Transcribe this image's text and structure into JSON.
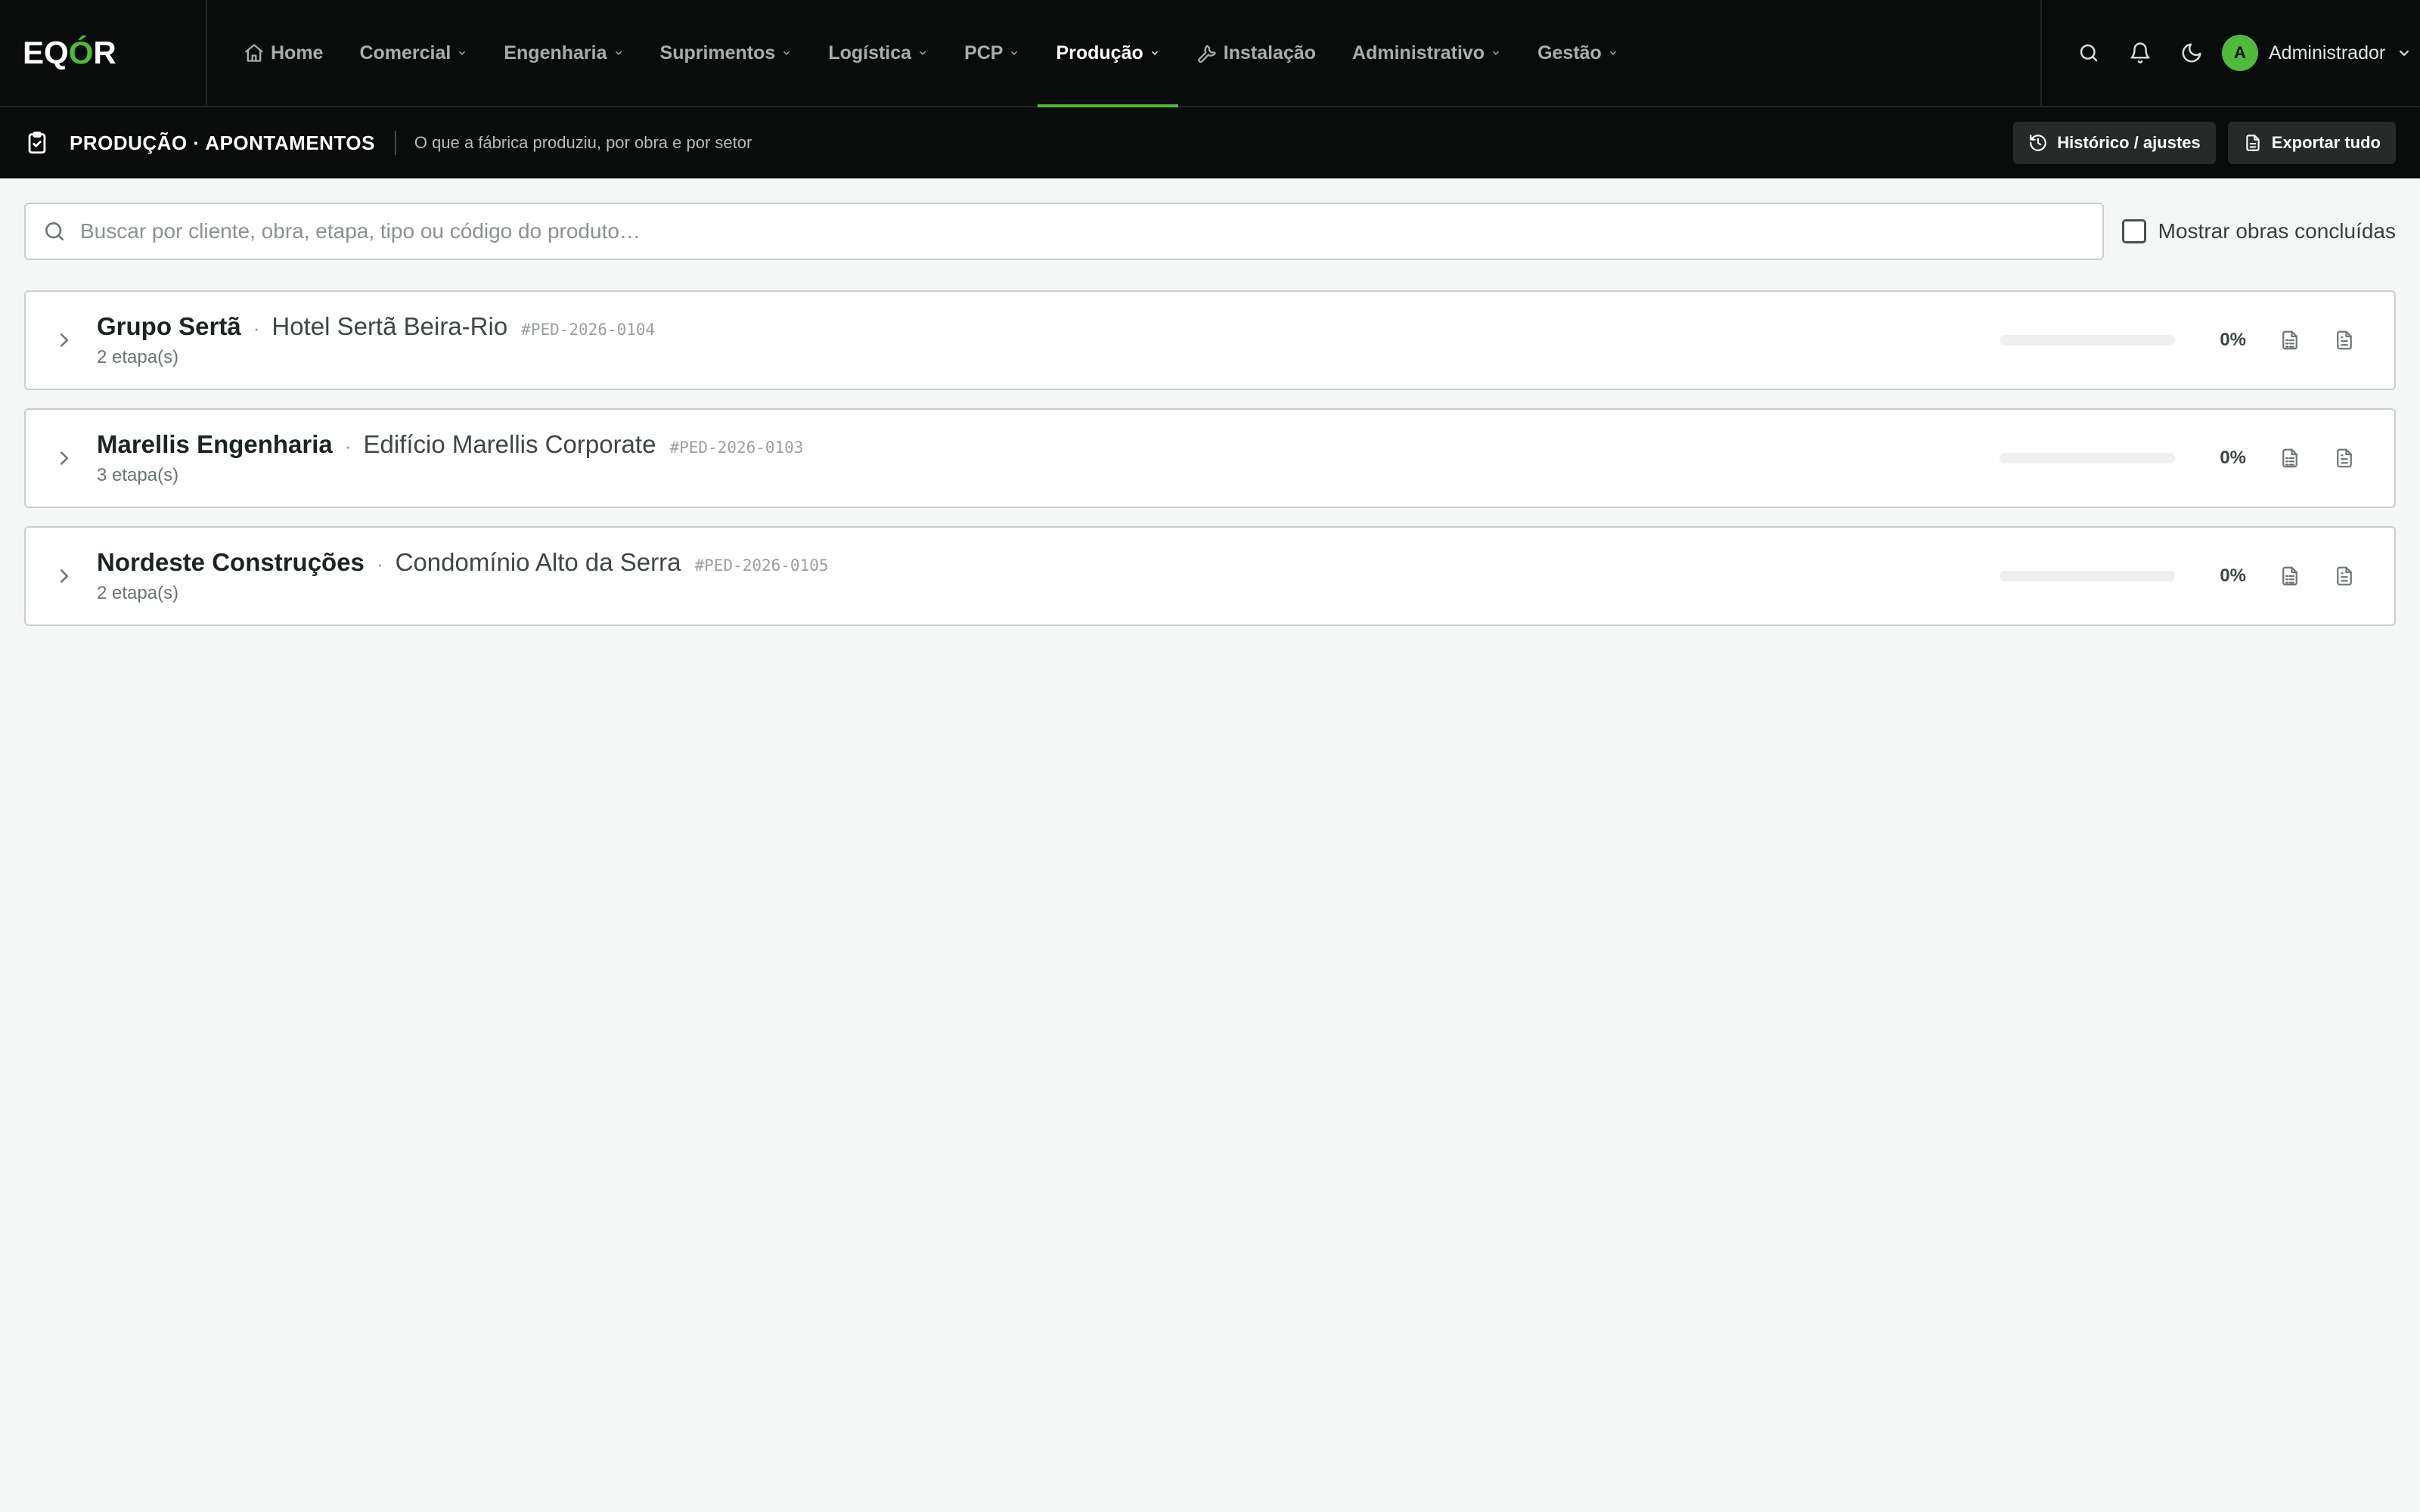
{
  "app": {
    "logo_pre": "EQ",
    "logo_accent": "Ó",
    "logo_post": "R"
  },
  "nav": {
    "items": [
      {
        "label": "Home"
      },
      {
        "label": "Comercial"
      },
      {
        "label": "Engenharia"
      },
      {
        "label": "Suprimentos"
      },
      {
        "label": "Logística"
      },
      {
        "label": "PCP"
      },
      {
        "label": "Produção"
      },
      {
        "label": "Instalação"
      },
      {
        "label": "Administrativo"
      },
      {
        "label": "Gestão"
      }
    ],
    "active": "Produção"
  },
  "user": {
    "initial": "A",
    "name": "Administrador"
  },
  "page": {
    "title": "PRODUÇÃO · APONTAMENTOS",
    "subtitle": "O que a fábrica produziu, por obra e por setor",
    "history_button": "Histórico / ajustes",
    "export_button": "Exportar tudo"
  },
  "search": {
    "placeholder": "Buscar por cliente, obra, etapa, tipo ou código do produto…",
    "value": ""
  },
  "filter": {
    "show_completed_label": "Mostrar obras concluídas",
    "show_completed": false
  },
  "orders": [
    {
      "client": "Grupo Sertã",
      "obra": "Hotel Sertã Beira-Rio",
      "code": "#PED-2026-0104",
      "stages": "2 etapa(s)",
      "progress": 0,
      "progress_label": "0%"
    },
    {
      "client": "Marellis Engenharia",
      "obra": "Edifício Marellis Corporate",
      "code": "#PED-2026-0103",
      "stages": "3 etapa(s)",
      "progress": 0,
      "progress_label": "0%"
    },
    {
      "client": "Nordeste Construções",
      "obra": "Condomínio Alto da Serra",
      "code": "#PED-2026-0105",
      "stages": "2 etapa(s)",
      "progress": 0,
      "progress_label": "0%"
    }
  ],
  "colors": {
    "accent": "#4fbb3a",
    "topbar": "#0a0c0b",
    "background": "#f5f7f6"
  },
  "icons": {
    "home": "home-icon",
    "instalacao": "wrench-icon",
    "search": "search-icon",
    "notifications": "bell-icon",
    "theme": "moon-icon",
    "page": "clipboard-check-icon",
    "history": "history-icon",
    "export": "file-icon",
    "expand": "chevron-right-icon",
    "sheet": "file-spreadsheet-icon",
    "doc": "file-text-icon"
  }
}
